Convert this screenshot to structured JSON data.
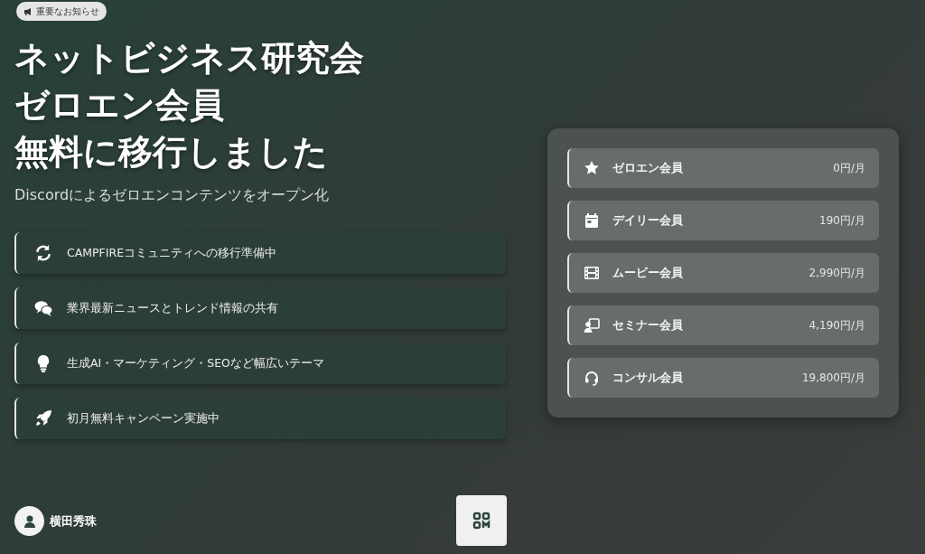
{
  "badge": "重要なお知らせ",
  "title_lines": [
    "ネットビジネス研究会",
    "ゼロエン会員",
    "無料に移行しました"
  ],
  "subtitle": "Discordによるゼロエンコンテンツをオープン化",
  "features": [
    {
      "text": "CAMPFIREコミュニティへの移行準備中"
    },
    {
      "text": "業界最新ニュースとトレンド情報の共有"
    },
    {
      "text": "生成AI・マーケティング・SEOなど幅広いテーマ"
    },
    {
      "text": "初月無料キャンペーン実施中"
    }
  ],
  "plans": [
    {
      "name": "ゼロエン会員",
      "price": "0円/月"
    },
    {
      "name": "デイリー会員",
      "price": "190円/月"
    },
    {
      "name": "ムービー会員",
      "price": "2,990円/月"
    },
    {
      "name": "セミナー会員",
      "price": "4,190円/月"
    },
    {
      "name": "コンサル会員",
      "price": "19,800円/月"
    }
  ],
  "author": "横田秀珠"
}
